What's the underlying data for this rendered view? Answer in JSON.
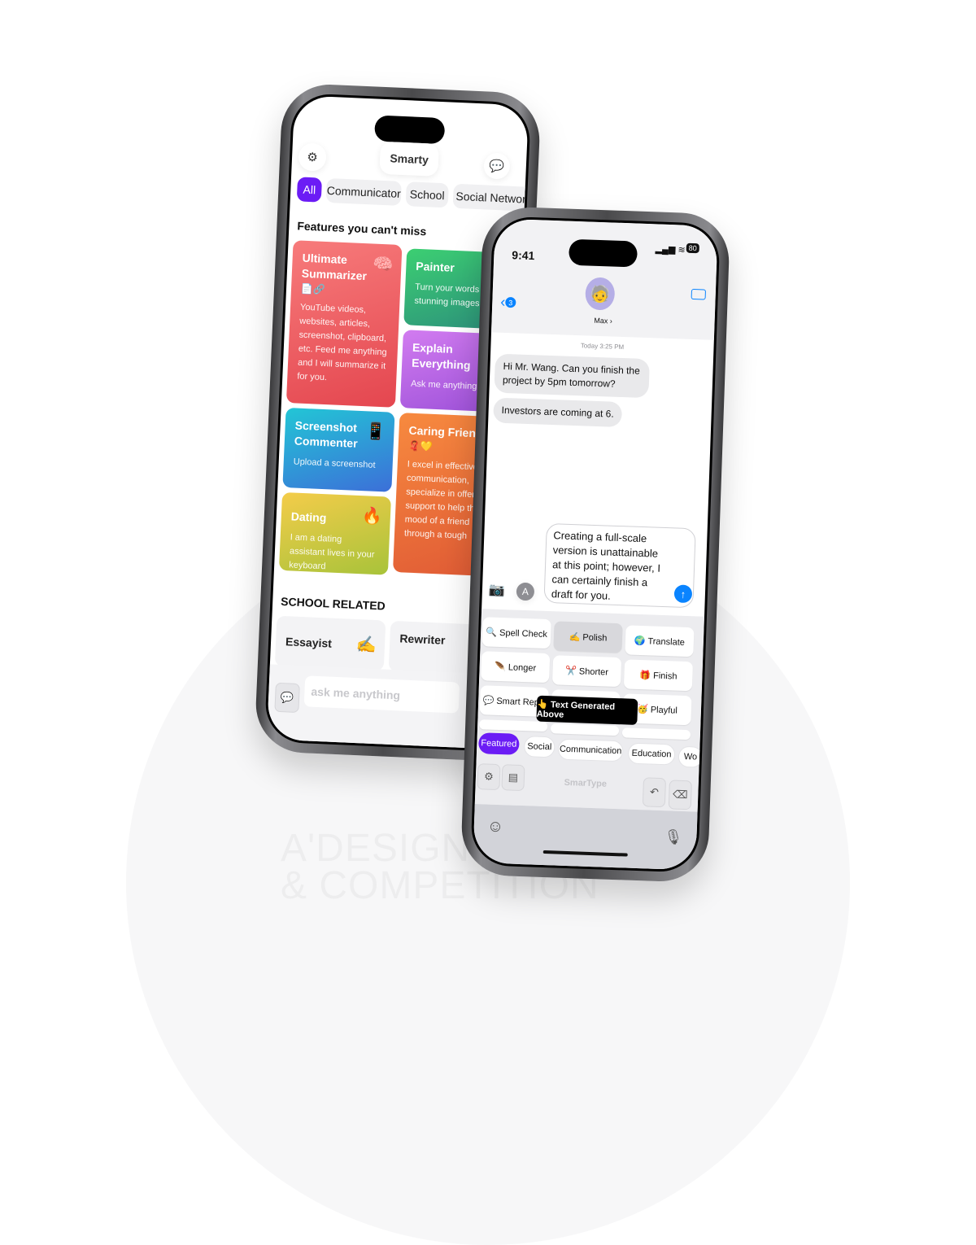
{
  "watermark": {
    "line1": "A'DESIGN AWARD",
    "line2": "& COMPETITION"
  },
  "colors": {
    "accent": "#6b1cf5",
    "ios_blue": "#0a84ff",
    "summarizer": "#ee5a5f",
    "painter": "#2fb07a",
    "explain": "#b25ee6",
    "screenshot": "#2a8fe0",
    "caring": "#f0743a",
    "dating": "#d7c133"
  },
  "left_app": {
    "title": "Smarty",
    "icons": {
      "settings": "gear-icon",
      "chat": "chat-bubble-icon"
    },
    "chips": [
      "All",
      "Communicator",
      "School",
      "Social Network"
    ],
    "section1": "Features you can't miss",
    "cards": [
      {
        "title": "Ultimate Summarizer",
        "emoji": "🧠",
        "sub_emoji": "📄🔗",
        "desc": "YouTube videos, websites, articles, screenshot, clipboard, etc. Feed me anything and I will summarize it for you."
      },
      {
        "title": "Painter",
        "desc": "Turn your words into stunning images"
      },
      {
        "title": "Explain Everything",
        "desc": "Ask me anything"
      },
      {
        "title": "Screenshot Commenter",
        "emoji": "📱",
        "desc": "Upload a screenshot"
      },
      {
        "title": "Caring Friend",
        "sub_emoji": "🧣💛",
        "desc": "I excel in effective communication, specialize in offering support to help the mood of a friend through a tough"
      },
      {
        "title": "Dating",
        "emoji": "🔥",
        "desc": "I am a dating assistant lives in your keyboard"
      }
    ],
    "section2": "SCHOOL RELATED",
    "school_cards": [
      {
        "title": "Essayist",
        "emoji": "✍️"
      },
      {
        "title": "Rewriter"
      }
    ],
    "input_placeholder": "ask me anything"
  },
  "right_app": {
    "status": {
      "time": "9:41",
      "battery": "80"
    },
    "back_badge": "3",
    "contact": "Max ›",
    "timestamp": "Today 3:25 PM",
    "messages": [
      "Hi Mr. Wang. Can you finish the project by 5pm tomorrow?",
      "Investors are coming at 6."
    ],
    "draft": "Creating a full-scale version is unattainable at this point; however, I can certainly finish a draft for you.",
    "keyboard_buttons": [
      {
        "label": "🔍 Spell Check",
        "selected": false
      },
      {
        "label": "✍️ Polish",
        "selected": true
      },
      {
        "label": "🌍 Translate",
        "selected": false
      },
      {
        "label": "🪶 Longer",
        "selected": false
      },
      {
        "label": "✂️ Shorter",
        "selected": false
      },
      {
        "label": "🎁 Finish",
        "selected": false
      },
      {
        "label": "💬 Smart Reply",
        "selected": false
      },
      {
        "label": "",
        "selected": false
      },
      {
        "label": "🥳 Playful",
        "selected": false
      }
    ],
    "tooltip": "👆 Text Generated Above",
    "tabs": [
      "Featured",
      "Social",
      "Communication",
      "Education",
      "Wo"
    ],
    "brand": "SmarType"
  }
}
